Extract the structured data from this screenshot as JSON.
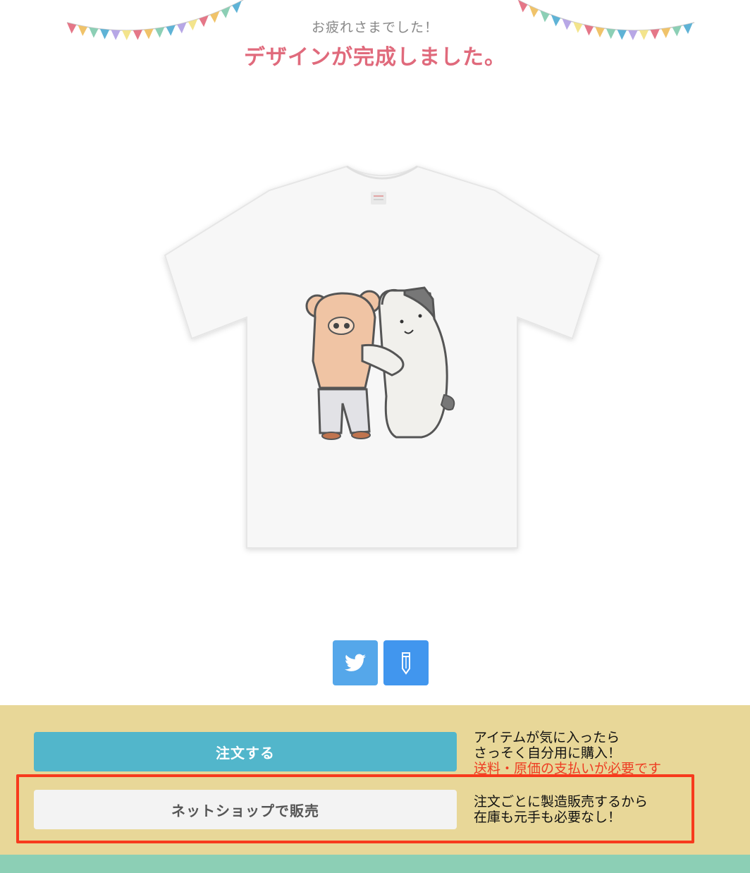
{
  "header": {
    "subtitle": "お疲れさまでした！",
    "title": "デザインが完成しました。"
  },
  "bunting_colors": [
    "#e57788",
    "#f0c36a",
    "#8ccfb5",
    "#5fb3d6",
    "#b7a7e6",
    "#f3e48c"
  ],
  "product": {
    "item": "Tシャツ",
    "shirt_color": "#f7f7f7",
    "bear_color": "#f0c4a4",
    "cat_color": "#f1f0ec"
  },
  "share": {
    "twitter_icon": "twitter-icon",
    "edit_icon": "pencil-icon"
  },
  "actions": {
    "order_label": "注文する",
    "order_desc_line1": "アイテムが気に入ったら",
    "order_desc_line2": "さっそく自分用に購入！",
    "order_desc_warn": "送料・原価の支払いが必要です",
    "shop_label": "ネットショップで販売",
    "shop_desc_line1": "注文ごとに製造販売するから",
    "shop_desc_line2": "在庫も元手も必要なし！"
  },
  "colors": {
    "title": "#e06a7c",
    "order_button": "#52b6cb",
    "panel": "#e8d798",
    "highlight": "#f73a1d",
    "warn_text": "#ee3d22"
  }
}
